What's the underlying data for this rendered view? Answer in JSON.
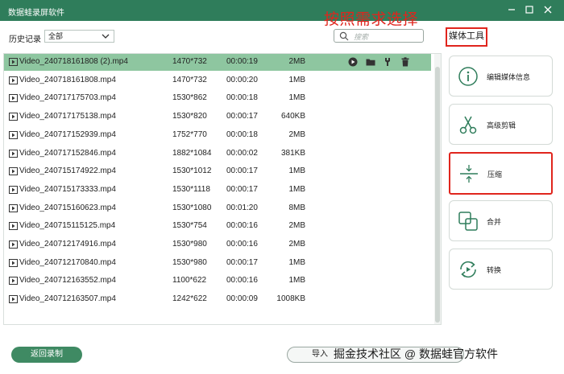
{
  "window": {
    "title": "数据蛙录屏软件"
  },
  "annotation": {
    "text": "按照需求选择"
  },
  "toolbar": {
    "history_label": "历史记录",
    "filter_value": "全部",
    "search_placeholder": "搜索"
  },
  "files": [
    {
      "name": "Video_240718161808 (2).mp4",
      "resolution": "1470*732",
      "duration": "00:00:19",
      "size": "2MB",
      "selected": true
    },
    {
      "name": "Video_240718161808.mp4",
      "resolution": "1470*732",
      "duration": "00:00:20",
      "size": "1MB"
    },
    {
      "name": "Video_240717175703.mp4",
      "resolution": "1530*862",
      "duration": "00:00:18",
      "size": "1MB"
    },
    {
      "name": "Video_240717175138.mp4",
      "resolution": "1530*820",
      "duration": "00:00:17",
      "size": "640KB"
    },
    {
      "name": "Video_240717152939.mp4",
      "resolution": "1752*770",
      "duration": "00:00:18",
      "size": "2MB"
    },
    {
      "name": "Video_240717152846.mp4",
      "resolution": "1882*1084",
      "duration": "00:00:02",
      "size": "381KB"
    },
    {
      "name": "Video_240715174922.mp4",
      "resolution": "1530*1012",
      "duration": "00:00:17",
      "size": "1MB"
    },
    {
      "name": "Video_240715173333.mp4",
      "resolution": "1530*1118",
      "duration": "00:00:17",
      "size": "1MB"
    },
    {
      "name": "Video_240715160623.mp4",
      "resolution": "1530*1080",
      "duration": "00:01:20",
      "size": "8MB"
    },
    {
      "name": "Video_240715115125.mp4",
      "resolution": "1530*754",
      "duration": "00:00:16",
      "size": "2MB"
    },
    {
      "name": "Video_240712174916.mp4",
      "resolution": "1530*980",
      "duration": "00:00:16",
      "size": "2MB"
    },
    {
      "name": "Video_240712170840.mp4",
      "resolution": "1530*980",
      "duration": "00:00:17",
      "size": "1MB"
    },
    {
      "name": "Video_240712163552.mp4",
      "resolution": "1100*622",
      "duration": "00:00:16",
      "size": "1MB"
    },
    {
      "name": "Video_240712163507.mp4",
      "resolution": "1242*622",
      "duration": "00:00:09",
      "size": "1008KB"
    }
  ],
  "media_tools": {
    "title": "媒体工具",
    "items": [
      {
        "label": "编辑媒体信息",
        "icon": "info-icon"
      },
      {
        "label": "高级剪辑",
        "icon": "scissors-icon"
      },
      {
        "label": "压缩",
        "icon": "compress-icon",
        "highlighted": true
      },
      {
        "label": "合并",
        "icon": "merge-icon"
      },
      {
        "label": "转换",
        "icon": "convert-icon"
      }
    ]
  },
  "bottom": {
    "back_label": "返回录制",
    "import_label": "导入"
  },
  "watermark": "掘金技术社区 @ 数据蛙官方软件",
  "colors": {
    "titlebar": "#2f7d5b",
    "selected_row": "#8ec6a0",
    "accent_red": "#e0251d",
    "button_green": "#3f8a63"
  }
}
